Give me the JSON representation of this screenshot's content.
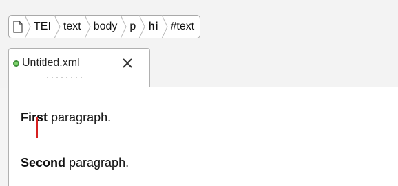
{
  "breadcrumb": {
    "items": [
      {
        "label": "",
        "icon": "document-icon",
        "bold": false
      },
      {
        "label": "TEI",
        "bold": false
      },
      {
        "label": "text",
        "bold": false
      },
      {
        "label": "body",
        "bold": false
      },
      {
        "label": "p",
        "bold": false
      },
      {
        "label": "hi",
        "bold": true
      },
      {
        "label": "#text",
        "bold": false
      }
    ]
  },
  "tabs": [
    {
      "label": "Untitled.xml",
      "status_color": "#7ed36d",
      "close_icon": "close-icon",
      "active": true
    }
  ],
  "editor": {
    "paragraphs": [
      {
        "bold_part_before_caret": "Fir",
        "bold_part_after_caret": "st",
        "rest": " paragraph."
      },
      {
        "bold_part": "Second",
        "rest": " paragraph."
      }
    ],
    "caret_color": "#d62020"
  }
}
